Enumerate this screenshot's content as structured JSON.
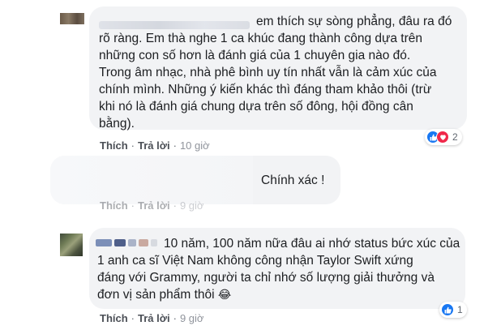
{
  "comments": [
    {
      "text_lines": [
        "em thích sự sòng phẳng, đâu ra đó",
        "rõ ràng. Em thà nghe 1 ca khúc đang thành công dựa trên",
        "những con số hơn là đánh giá của 1 chuyên gia nào đó.",
        "Trong âm nhạc, nhà phê bình uy tín nhất vẫn là cảm xúc của",
        "chính mình. Những ý kiến khác thì đáng tham khảo thôi (trừ",
        "khi nó là đánh giá chung dựa trên số đông, hội đồng cân",
        "bằng)."
      ],
      "like_label": "Thích",
      "reply_label": "Trả lời",
      "time": "10 giờ",
      "reactions": {
        "icons": [
          "like-icon",
          "heart-icon"
        ],
        "count": "2"
      }
    },
    {
      "text": "Chính xác !",
      "like_label": "Thích",
      "reply_label": "Trả lời",
      "time": "9 giờ"
    },
    {
      "text_lines": [
        "10 năm, 100 năm nữa đâu ai nhớ status bức xúc của",
        "1 anh ca sĩ Việt Nam không công nhận Taylor Swift xứng",
        "đáng với Grammy, người ta chỉ nhớ số lượng giải thưởng và",
        "đơn vị sản phẩm thôi"
      ],
      "emoji": "😂",
      "like_label": "Thích",
      "reply_label": "Trả lời",
      "time": "9 giờ",
      "reactions": {
        "icons": [
          "like-icon"
        ],
        "count": "1"
      }
    }
  ],
  "colors": {
    "bubble": "#f2f3f5",
    "like_blue": "#1877f2",
    "heart_red": "#f0284a",
    "action_text": "#4b4f56",
    "meta_text": "#90949c"
  }
}
